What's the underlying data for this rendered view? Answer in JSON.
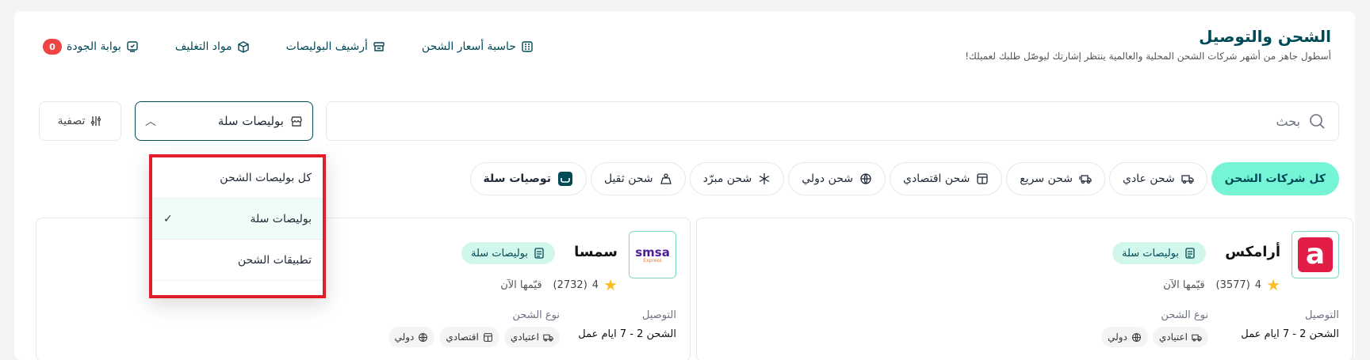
{
  "header": {
    "title": "الشحن والتوصيل",
    "subtitle": "أسطول جاهز من أشهر شركات الشحن المحلية والعالمية ينتظر إشارتك ليوصّل طلبك لعميلك!",
    "links": [
      {
        "label": "بوابة الجودة",
        "icon": "quality-icon",
        "badge": "0"
      },
      {
        "label": "مواد التغليف",
        "icon": "box-icon"
      },
      {
        "label": "أرشيف البوليصات",
        "icon": "archive-icon"
      },
      {
        "label": "حاسبة أسعار الشحن",
        "icon": "calculator-icon"
      }
    ]
  },
  "search": {
    "placeholder": "بحث"
  },
  "policy_select": {
    "value": "بوليصات سلة"
  },
  "filter_button": {
    "label": "تصفية"
  },
  "tabs": [
    {
      "label": "كل شركات الشحن",
      "active": true
    },
    {
      "label": "شحن عادي",
      "icon": "truck-icon"
    },
    {
      "label": "شحن سريع",
      "icon": "fast-truck-icon"
    },
    {
      "label": "شحن اقتصادي",
      "icon": "economy-icon"
    },
    {
      "label": "شحن دولي",
      "icon": "globe-icon"
    },
    {
      "label": "شحن مبرّد",
      "icon": "snowflake-icon"
    },
    {
      "label": "شحن ثقيل",
      "icon": "weight-icon"
    },
    {
      "label": "توصيات سلة",
      "icon": "salla-icon"
    }
  ],
  "dropdown": {
    "items": [
      {
        "label": "كل بوليصات الشحن"
      },
      {
        "label": "بوليصات سلة",
        "selected": true,
        "check": "✓"
      },
      {
        "label": "تطبيقات الشحن"
      }
    ]
  },
  "cards": [
    {
      "name": "أرامكس",
      "logo_text": "a",
      "badge": "بوليصات سلة",
      "rating": "4",
      "reviews": "(3577)",
      "rate_link": "قيّمها الآن",
      "delivery_label": "التوصيل",
      "delivery_value": "الشحن 2 - 7 ايام عمل",
      "type_label": "نوع الشحن",
      "chips": [
        "اعتيادي",
        "دولي"
      ]
    },
    {
      "name": "سمسا",
      "logo_text": "smsa",
      "logo_sub": "Express",
      "badge": "بوليصات سلة",
      "rating": "4",
      "reviews": "(2732)",
      "rate_link": "قيّمها الآن",
      "delivery_label": "التوصيل",
      "delivery_value": "الشحن 2 - 7 ايام عمل",
      "type_label": "نوع الشحن",
      "chips": [
        "اعتيادي",
        "اقتصادي",
        "دولي"
      ]
    }
  ],
  "colors": {
    "brand": "#004956",
    "accent": "#76f5d6",
    "danger": "#ef4444",
    "highlight_border": "#e11d2a"
  }
}
